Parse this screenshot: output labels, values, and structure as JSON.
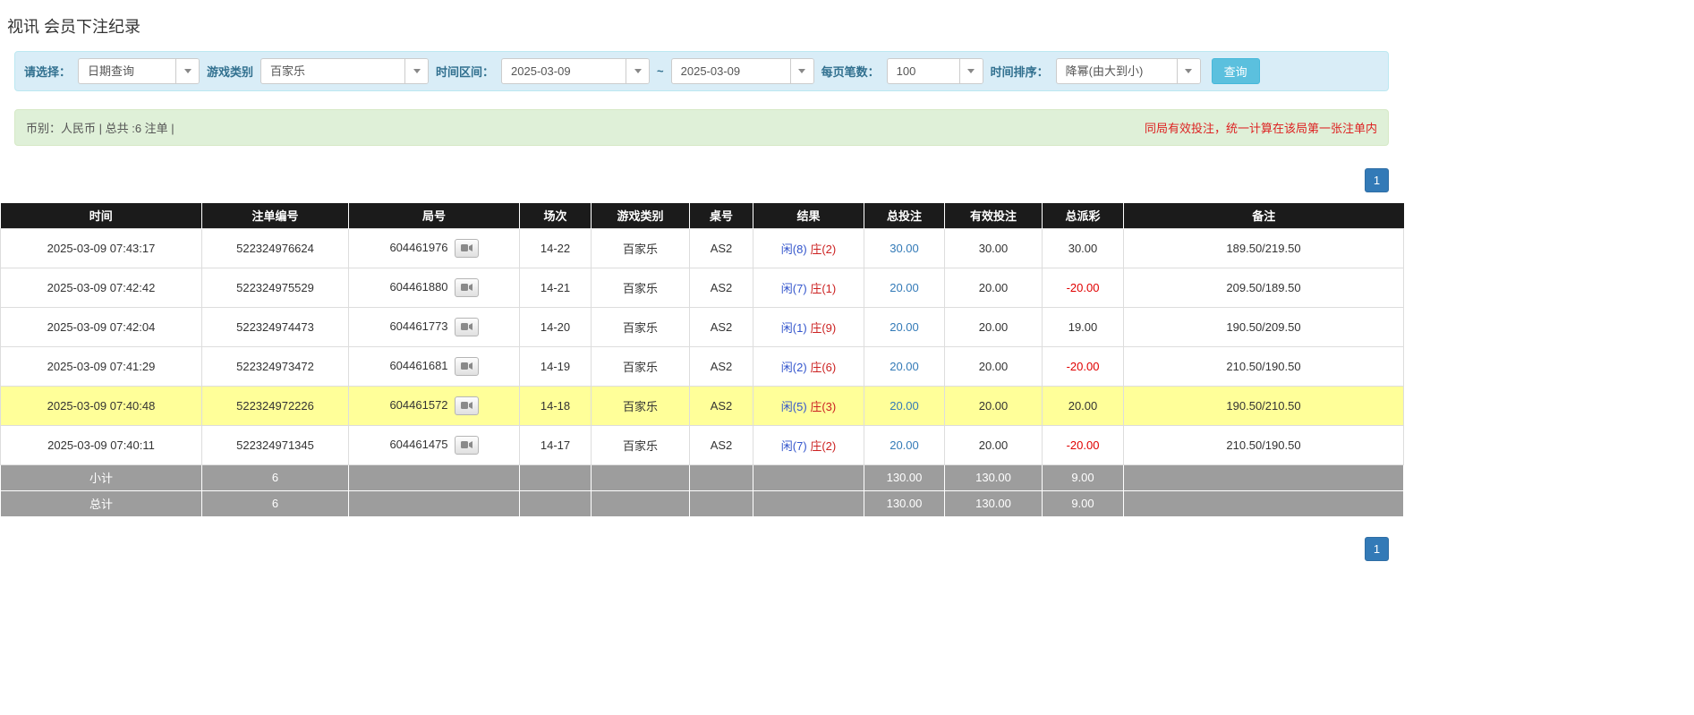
{
  "page": {
    "title": "视讯 会员下注纪录"
  },
  "filter_bar": {
    "select_label": "请选择：",
    "select_value": "日期查询",
    "game_type_label": "游戏类别",
    "game_type_value": "百家乐",
    "time_range_label": "时间区间：",
    "date_from": "2025-03-09",
    "date_separator": "~",
    "date_to": "2025-03-09",
    "page_size_label": "每页笔数：",
    "page_size_value": "100",
    "sort_label": "时间排序：",
    "sort_value": "降幂(由大到小)",
    "search_button_label": "查询"
  },
  "summary_bar": {
    "left_text": "币别：人民币 | 总共 :6 注单 |",
    "right_text": "同局有效投注，统一计算在该局第一张注单内"
  },
  "pagination": {
    "current_page": "1"
  },
  "table": {
    "headers": [
      "时间",
      "注单编号",
      "局号",
      "场次",
      "游戏类别",
      "桌号",
      "结果",
      "总投注",
      "有效投注",
      "总派彩",
      "备注"
    ],
    "rows": [
      {
        "time": "2025-03-09 07:43:17",
        "bet_no": "522324976624",
        "round_no": "604461976",
        "session": "14-22",
        "game": "百家乐",
        "table_no": "AS2",
        "player": "闲(8)",
        "banker": "庄(2)",
        "total_bet": "30.00",
        "valid_bet": "30.00",
        "payout": "30.00",
        "note": "189.50/219.50",
        "highlighted": false
      },
      {
        "time": "2025-03-09 07:42:42",
        "bet_no": "522324975529",
        "round_no": "604461880",
        "session": "14-21",
        "game": "百家乐",
        "table_no": "AS2",
        "player": "闲(7)",
        "banker": "庄(1)",
        "total_bet": "20.00",
        "valid_bet": "20.00",
        "payout": "-20.00",
        "note": "209.50/189.50",
        "highlighted": false
      },
      {
        "time": "2025-03-09 07:42:04",
        "bet_no": "522324974473",
        "round_no": "604461773",
        "session": "14-20",
        "game": "百家乐",
        "table_no": "AS2",
        "player": "闲(1)",
        "banker": "庄(9)",
        "total_bet": "20.00",
        "valid_bet": "20.00",
        "payout": "19.00",
        "note": "190.50/209.50",
        "highlighted": false
      },
      {
        "time": "2025-03-09 07:41:29",
        "bet_no": "522324973472",
        "round_no": "604461681",
        "session": "14-19",
        "game": "百家乐",
        "table_no": "AS2",
        "player": "闲(2)",
        "banker": "庄(6)",
        "total_bet": "20.00",
        "valid_bet": "20.00",
        "payout": "-20.00",
        "note": "210.50/190.50",
        "highlighted": false
      },
      {
        "time": "2025-03-09 07:40:48",
        "bet_no": "522324972226",
        "round_no": "604461572",
        "session": "14-18",
        "game": "百家乐",
        "table_no": "AS2",
        "player": "闲(5)",
        "banker": "庄(3)",
        "total_bet": "20.00",
        "valid_bet": "20.00",
        "payout": "20.00",
        "note": "190.50/210.50",
        "highlighted": true
      },
      {
        "time": "2025-03-09 07:40:11",
        "bet_no": "522324971345",
        "round_no": "604461475",
        "session": "14-17",
        "game": "百家乐",
        "table_no": "AS2",
        "player": "闲(7)",
        "banker": "庄(2)",
        "total_bet": "20.00",
        "valid_bet": "20.00",
        "payout": "-20.00",
        "note": "210.50/190.50",
        "highlighted": false
      }
    ],
    "subtotal": {
      "label": "小计",
      "count": "6",
      "total_bet": "130.00",
      "valid_bet": "130.00",
      "payout": "9.00"
    },
    "total": {
      "label": "总计",
      "count": "6",
      "total_bet": "130.00",
      "valid_bet": "130.00",
      "payout": "9.00"
    }
  },
  "icons": {
    "combo_caret": "caret-down-icon",
    "round_replay": "video-camera-icon"
  },
  "colors": {
    "filter_bar_bg": "#d9edf7",
    "summary_bar_bg": "#dff0d8",
    "search_button": "#5bc0de",
    "pagination_active": "#337ab7",
    "header_bg": "#1b1b1b",
    "footer_bg": "#9d9d9d",
    "highlight_row": "#ffff99",
    "player_blue": "#3355cc",
    "banker_red": "#cc2222",
    "negative_red": "#e00000",
    "bet_link_blue": "#337ab7",
    "warning_red_text": "#dd2222"
  }
}
